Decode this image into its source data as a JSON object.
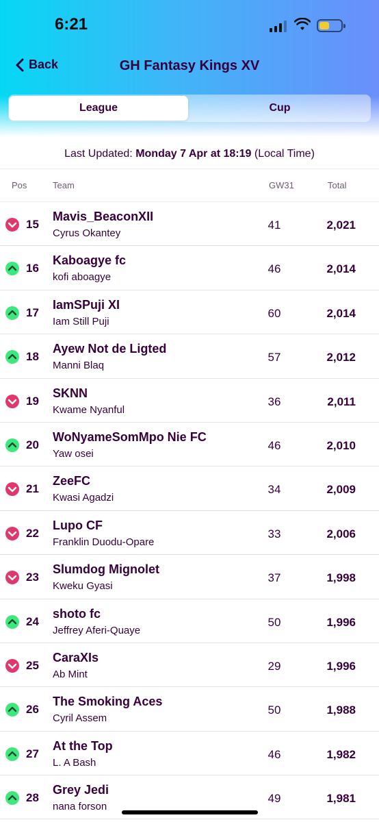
{
  "status": {
    "time": "6:21"
  },
  "nav": {
    "back_label": "Back",
    "title": "GH Fantasy Kings XV"
  },
  "tabs": [
    {
      "label": "League",
      "active": true
    },
    {
      "label": "Cup",
      "active": false
    }
  ],
  "last_updated": {
    "prefix": "Last Updated: ",
    "date": "Monday 7 Apr at 18:19",
    "suffix": " (Local Time)"
  },
  "columns": {
    "pos": "Pos",
    "team": "Team",
    "gw": "GW31",
    "total": "Total"
  },
  "colors": {
    "up": "#3fe87f",
    "down": "#e0386c",
    "text": "#37003c"
  },
  "rows": [
    {
      "movement": "down",
      "rank": "15",
      "team": "Mavis_BeaconXII",
      "manager": "Cyrus Okantey",
      "gw": "41",
      "total": "2,021"
    },
    {
      "movement": "up",
      "rank": "16",
      "team": "Kaboagye fc",
      "manager": "kofi aboagye",
      "gw": "46",
      "total": "2,014"
    },
    {
      "movement": "up",
      "rank": "17",
      "team": "IamSPuji XI",
      "manager": "Iam Still Puji",
      "gw": "60",
      "total": "2,014"
    },
    {
      "movement": "up",
      "rank": "18",
      "team": "Ayew Not de Ligted",
      "manager": "Manni Blaq",
      "gw": "57",
      "total": "2,012"
    },
    {
      "movement": "down",
      "rank": "19",
      "team": "SKNN",
      "manager": "Kwame Nyanful",
      "gw": "36",
      "total": "2,011"
    },
    {
      "movement": "up",
      "rank": "20",
      "team": "WoNyameSomMpo Nie FC",
      "manager": "Yaw osei",
      "gw": "46",
      "total": "2,010"
    },
    {
      "movement": "down",
      "rank": "21",
      "team": "ZeeFC",
      "manager": "Kwasi Agadzi",
      "gw": "34",
      "total": "2,009"
    },
    {
      "movement": "down",
      "rank": "22",
      "team": "Lupo CF",
      "manager": "Franklin Duodu-Opare",
      "gw": "33",
      "total": "2,006"
    },
    {
      "movement": "down",
      "rank": "23",
      "team": "Slumdog Mignolet",
      "manager": "Kweku Gyasi",
      "gw": "37",
      "total": "1,998"
    },
    {
      "movement": "up",
      "rank": "24",
      "team": "shoto fc",
      "manager": "Jeffrey Aferi-Quaye",
      "gw": "50",
      "total": "1,996"
    },
    {
      "movement": "down",
      "rank": "25",
      "team": "CaraXIs",
      "manager": "Ab Mint",
      "gw": "29",
      "total": "1,996"
    },
    {
      "movement": "up",
      "rank": "26",
      "team": "The Smoking Aces",
      "manager": "Cyril Assem",
      "gw": "50",
      "total": "1,988"
    },
    {
      "movement": "up",
      "rank": "27",
      "team": "At the Top",
      "manager": "L. A Bash",
      "gw": "46",
      "total": "1,982"
    },
    {
      "movement": "up",
      "rank": "28",
      "team": "Grey Jedi",
      "manager": "nana forson",
      "gw": "49",
      "total": "1,981"
    }
  ]
}
